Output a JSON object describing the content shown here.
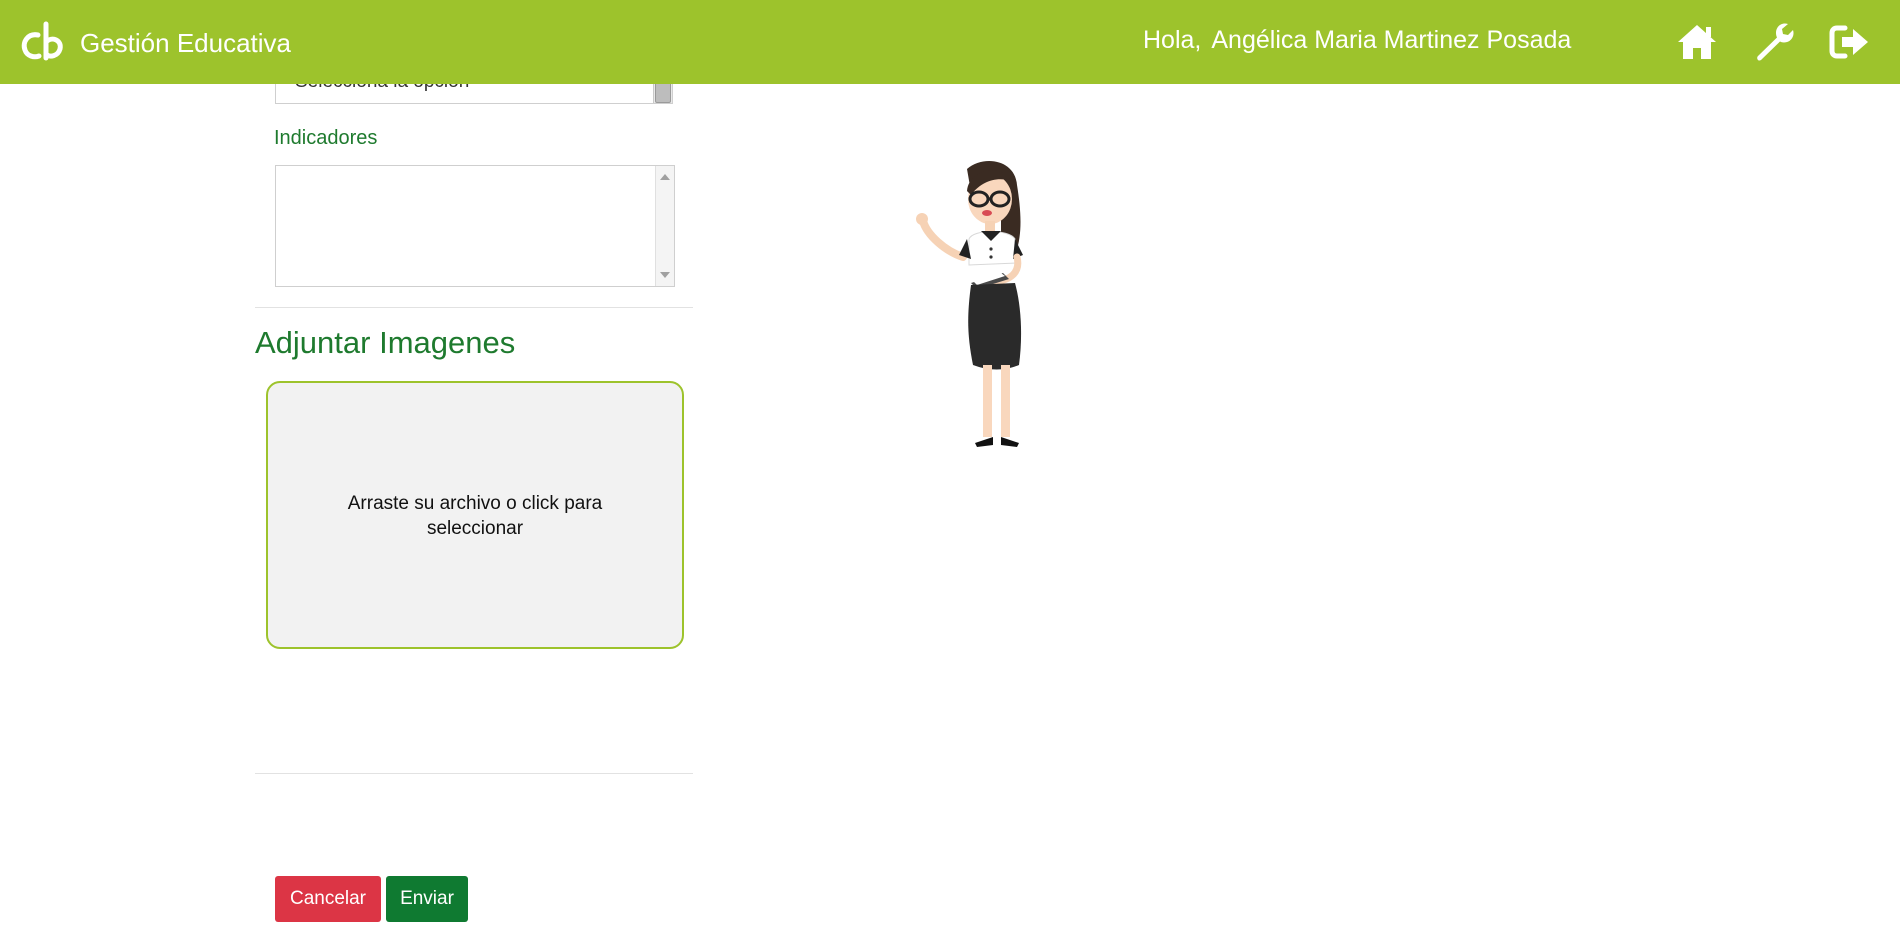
{
  "header": {
    "app_title": "Gestión Educativa",
    "greeting": "Hola,",
    "user_name": "Angélica Maria Martinez Posada",
    "nav_icons": [
      "home-icon",
      "wrench-icon",
      "logout-icon"
    ],
    "bar_color": "#9dc32c"
  },
  "form": {
    "select_value": "Selecciona la opción",
    "indicators_label": "Indicadores",
    "indicators_value": "",
    "attach_title": "Adjuntar Imagenes",
    "dropzone_text": "Arraste su archivo o click para seleccionar"
  },
  "actions": {
    "cancel_label": "Cancelar",
    "send_label": "Enviar",
    "cancel_color": "#dc3545",
    "send_color": "#0f7a31"
  }
}
